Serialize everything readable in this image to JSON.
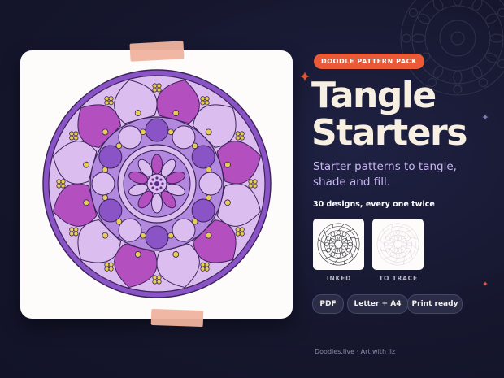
{
  "badge": "DOODLE PATTERN PACK",
  "title_line1": "Tangle",
  "title_line2": "Starters",
  "subtitle": "Starter patterns to tangle, shade and fill.",
  "designs_text": "30 designs, every one twice",
  "thumbnails": [
    {
      "label": "INKED",
      "icon": "inked-mandala-thumbnail"
    },
    {
      "label": "TO TRACE",
      "icon": "trace-mandala-thumbnail"
    }
  ],
  "chips": [
    "PDF",
    "Letter + A4",
    "Print ready"
  ],
  "footer": "Doodles.live · Art with ilz",
  "colors": {
    "background": "#16172e",
    "accent": "#ea5a36",
    "title": "#f6efe2",
    "subtitle": "#c9b6f2",
    "mandala_dark": "#8a54c6",
    "mandala_mid": "#b389df",
    "mandala_light": "#dcbdf0",
    "mandala_magenta": "#b44fbf",
    "mandala_accent_yellow": "#e6cd55",
    "tape": "#efb39f"
  }
}
